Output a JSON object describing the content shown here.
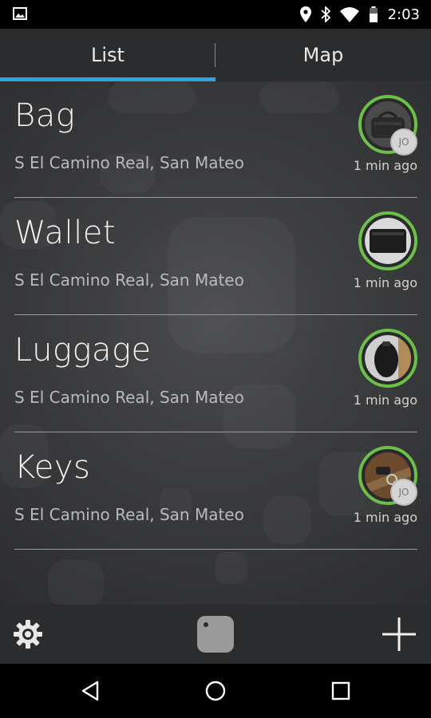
{
  "status_bar": {
    "time": "2:03",
    "icons": [
      "image-icon",
      "location-icon",
      "bluetooth-icon",
      "wifi-icon",
      "battery-icon"
    ]
  },
  "tabs": [
    {
      "label": "List",
      "selected": true
    },
    {
      "label": "Map",
      "selected": false
    }
  ],
  "items": [
    {
      "title": "Bag",
      "location": "S El Camino Real, San Mateo",
      "time": "1 min ago",
      "badge": "JO",
      "image": "bag-photo"
    },
    {
      "title": "Wallet",
      "location": "S El Camino Real, San Mateo",
      "time": "1 min ago",
      "badge": "",
      "image": "wallet-photo"
    },
    {
      "title": "Luggage",
      "location": "S El Camino Real, San Mateo",
      "time": "1 min ago",
      "badge": "",
      "image": "luggage-photo"
    },
    {
      "title": "Keys",
      "location": "S El Camino Real, San Mateo",
      "time": "1 min ago",
      "badge": "JO",
      "image": "keys-photo"
    }
  ],
  "toolbar": {
    "icons": [
      "gear-icon",
      "tile-icon",
      "plus-icon"
    ]
  },
  "nav_bar": {
    "icons": [
      "back-icon",
      "home-icon",
      "recents-icon"
    ]
  },
  "colors": {
    "accent_underline": "#27a7de",
    "ring_green": "#6cc04a",
    "bar_background": "#2b2c2e"
  }
}
